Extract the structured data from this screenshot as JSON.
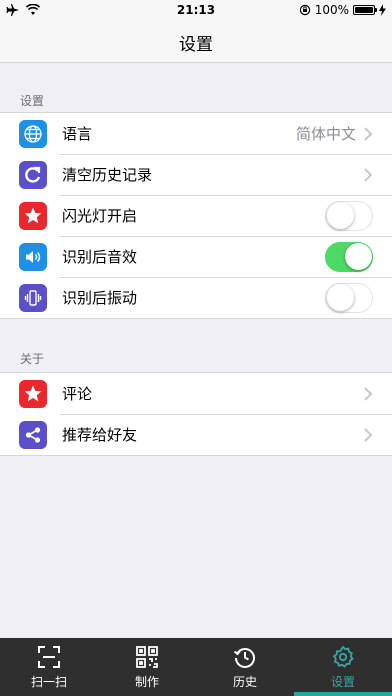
{
  "status_bar": {
    "time": "21:13",
    "battery": "100%"
  },
  "navbar": {
    "title": "设置"
  },
  "sections": [
    {
      "header": "设置",
      "items": [
        {
          "label": "语言",
          "value": "简体中文",
          "icon": "globe-icon",
          "color": "#1e90e6",
          "accessory": "chevron"
        },
        {
          "label": "清空历史记录",
          "icon": "refresh-icon",
          "color": "#5b50c8",
          "accessory": "chevron"
        },
        {
          "label": "闪光灯开启",
          "icon": "star-icon",
          "color": "#e8282e",
          "accessory": "toggle",
          "on": false
        },
        {
          "label": "识别后音效",
          "icon": "speaker-icon",
          "color": "#1e90e6",
          "accessory": "toggle",
          "on": true
        },
        {
          "label": "识别后振动",
          "icon": "vibrate-icon",
          "color": "#5b50c8",
          "accessory": "toggle",
          "on": false
        }
      ]
    },
    {
      "header": "关于",
      "items": [
        {
          "label": "评论",
          "icon": "star-icon",
          "color": "#e8282e",
          "accessory": "chevron"
        },
        {
          "label": "推荐给好友",
          "icon": "share-icon",
          "color": "#5b50c8",
          "accessory": "chevron"
        }
      ]
    }
  ],
  "tabs": [
    {
      "label": "扫一扫",
      "icon": "scan-icon",
      "active": false
    },
    {
      "label": "制作",
      "icon": "qr-code-icon",
      "active": false
    },
    {
      "label": "历史",
      "icon": "history-icon",
      "active": false
    },
    {
      "label": "设置",
      "icon": "gear-icon",
      "active": true
    }
  ],
  "colors": {
    "toggle_on": "#4cd964",
    "tab_active": "#3aa7a6",
    "tab_bar": "#2f2f2f"
  }
}
